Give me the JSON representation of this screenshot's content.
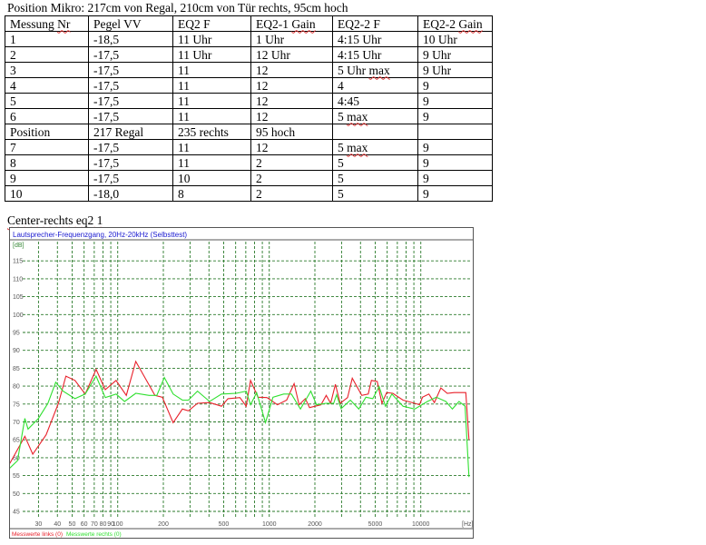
{
  "position_title": "Position Mikro: 217cm von Regal, 210cm von Tür rechts, 95cm hoch",
  "table": {
    "headers": [
      "Messung Nr",
      "Pegel VV",
      "EQ2 F",
      "EQ2-1 Gain",
      "EQ2-2 F",
      "EQ2-2 Gain"
    ],
    "rows": [
      [
        "1",
        "-18,5",
        "11 Uhr",
        "1 Uhr",
        "4:15 Uhr",
        "10 Uhr"
      ],
      [
        "2",
        "-17,5",
        "11 Uhr",
        "12 Uhr",
        "4:15 Uhr",
        "9 Uhr"
      ],
      [
        "3",
        "-17,5",
        "11",
        "12",
        "5 Uhr max",
        "9 Uhr"
      ],
      [
        "4",
        "-17,5",
        "11",
        "12",
        "4",
        "9"
      ],
      [
        "5",
        "-17,5",
        "11",
        "12",
        "4:45",
        "9"
      ],
      [
        "6",
        "-17,5",
        "11",
        "12",
        "5 max",
        "9"
      ],
      [
        "Position",
        "217 Regal",
        "235 rechts",
        "95 hoch",
        "",
        ""
      ],
      [
        "7",
        "-17,5",
        "11",
        "12",
        "5 max",
        "9"
      ],
      [
        "8",
        "-17,5",
        "11",
        "2",
        "5",
        "9"
      ],
      [
        "9",
        "-17,5",
        "10",
        "2",
        "5",
        "9"
      ],
      [
        "10",
        "-18,0",
        "8",
        "2",
        "5",
        "9"
      ]
    ]
  },
  "chart_caption": "Center-rechts eq2 1",
  "chart_data": {
    "type": "line",
    "title": "Lautsprecher-Frequenzgang, 20Hz-20kHz (Selbsttest)",
    "xlabel": "[Hz]",
    "ylabel": "[dB]",
    "xscale": "log",
    "xlim": [
      20,
      20500
    ],
    "ylim": [
      45,
      117
    ],
    "yticks": [
      45,
      50,
      55,
      60,
      65,
      70,
      75,
      80,
      85,
      90,
      95,
      100,
      105,
      110,
      115
    ],
    "xtick_labels": [
      30,
      40,
      50,
      60,
      70,
      80,
      90,
      100,
      200,
      500,
      1000,
      2000,
      5000,
      10000
    ],
    "xgrid": [
      30,
      40,
      50,
      60,
      70,
      80,
      90,
      100,
      200,
      300,
      400,
      500,
      600,
      700,
      800,
      900,
      1000,
      2000,
      3000,
      4000,
      5000,
      6000,
      7000,
      8000,
      9000,
      10000
    ],
    "grid": true,
    "legend_position": "bottom",
    "colors": {
      "links": "#e8202a",
      "rechts": "#30e030",
      "grid": "#2a7a2a",
      "title": "#1a1ad0"
    },
    "series": [
      {
        "name": "Messwerte links (0)",
        "color": "#e8202a",
        "x": [
          19.4,
          24.4,
          27.5,
          33.7,
          40.6,
          45.5,
          52.2,
          61,
          72,
          82.7,
          97.5,
          114,
          131.6,
          161,
          176,
          197,
          232,
          267,
          293,
          336,
          404,
          484,
          534,
          640,
          704,
          752,
          843,
          966,
          1131,
          1302,
          1459,
          1574,
          1730,
          1844,
          2194,
          2376,
          2542,
          2731,
          2937,
          3286,
          3530,
          4080,
          4500,
          4720,
          5160,
          5540,
          5950,
          6540,
          7630,
          9120,
          9800,
          10260,
          11300,
          12300,
          13560,
          14950,
          16600,
          18200,
          19800,
          20800
        ],
        "y": [
          58.4,
          66,
          61,
          66.4,
          75.2,
          82.8,
          81.6,
          77.8,
          84.7,
          79,
          81.6,
          77.4,
          86.9,
          80.3,
          77.4,
          76.9,
          69.8,
          73.6,
          73.1,
          75.2,
          75.4,
          74.4,
          76.5,
          76.8,
          74.4,
          81.6,
          76.9,
          76.8,
          74.8,
          76.1,
          80.7,
          74.8,
          76.5,
          74,
          74.8,
          77.4,
          75.2,
          80.5,
          75.2,
          76.8,
          82.2,
          77.4,
          77.8,
          81.6,
          81.3,
          75.2,
          78.2,
          78,
          76.1,
          75.2,
          74.8,
          76.9,
          77.8,
          75.4,
          79.5,
          78,
          78.2,
          78.2,
          78.2,
          65
        ]
      },
      {
        "name": "Messwerte rechts (0)",
        "color": "#30e030",
        "x": [
          19.4,
          21.8,
          24.4,
          25.6,
          30,
          34.6,
          39,
          43.6,
          52.2,
          61,
          72,
          82.7,
          97.5,
          111,
          131.6,
          161,
          181,
          203,
          232,
          267,
          293,
          336,
          404,
          484,
          606,
          704,
          752,
          825,
          945,
          1058,
          1244,
          1400,
          1606,
          1880,
          2050,
          2376,
          2660,
          2780,
          2980,
          3430,
          3900,
          4340,
          4820,
          5310,
          5840,
          6440,
          7630,
          9120,
          11050,
          12650,
          14630,
          16150,
          17850,
          19580,
          20800
        ],
        "y": [
          57.1,
          59.2,
          71,
          68,
          71,
          75.2,
          81.1,
          78.6,
          76.5,
          77.8,
          82.8,
          76.8,
          77.8,
          75.7,
          78,
          77.4,
          77.4,
          82.4,
          77.8,
          76.1,
          76.1,
          78.6,
          75.7,
          77.8,
          78,
          78.6,
          74.8,
          78.2,
          69.8,
          76.9,
          77.8,
          77.8,
          73.6,
          78.6,
          74.8,
          75.2,
          75.2,
          77.6,
          73.7,
          76.1,
          73.6,
          76.9,
          76.5,
          79.9,
          74.4,
          77.8,
          74.4,
          73.6,
          75.7,
          76.9,
          75.7,
          73.6,
          75.7,
          74.4,
          54.6
        ]
      }
    ]
  }
}
